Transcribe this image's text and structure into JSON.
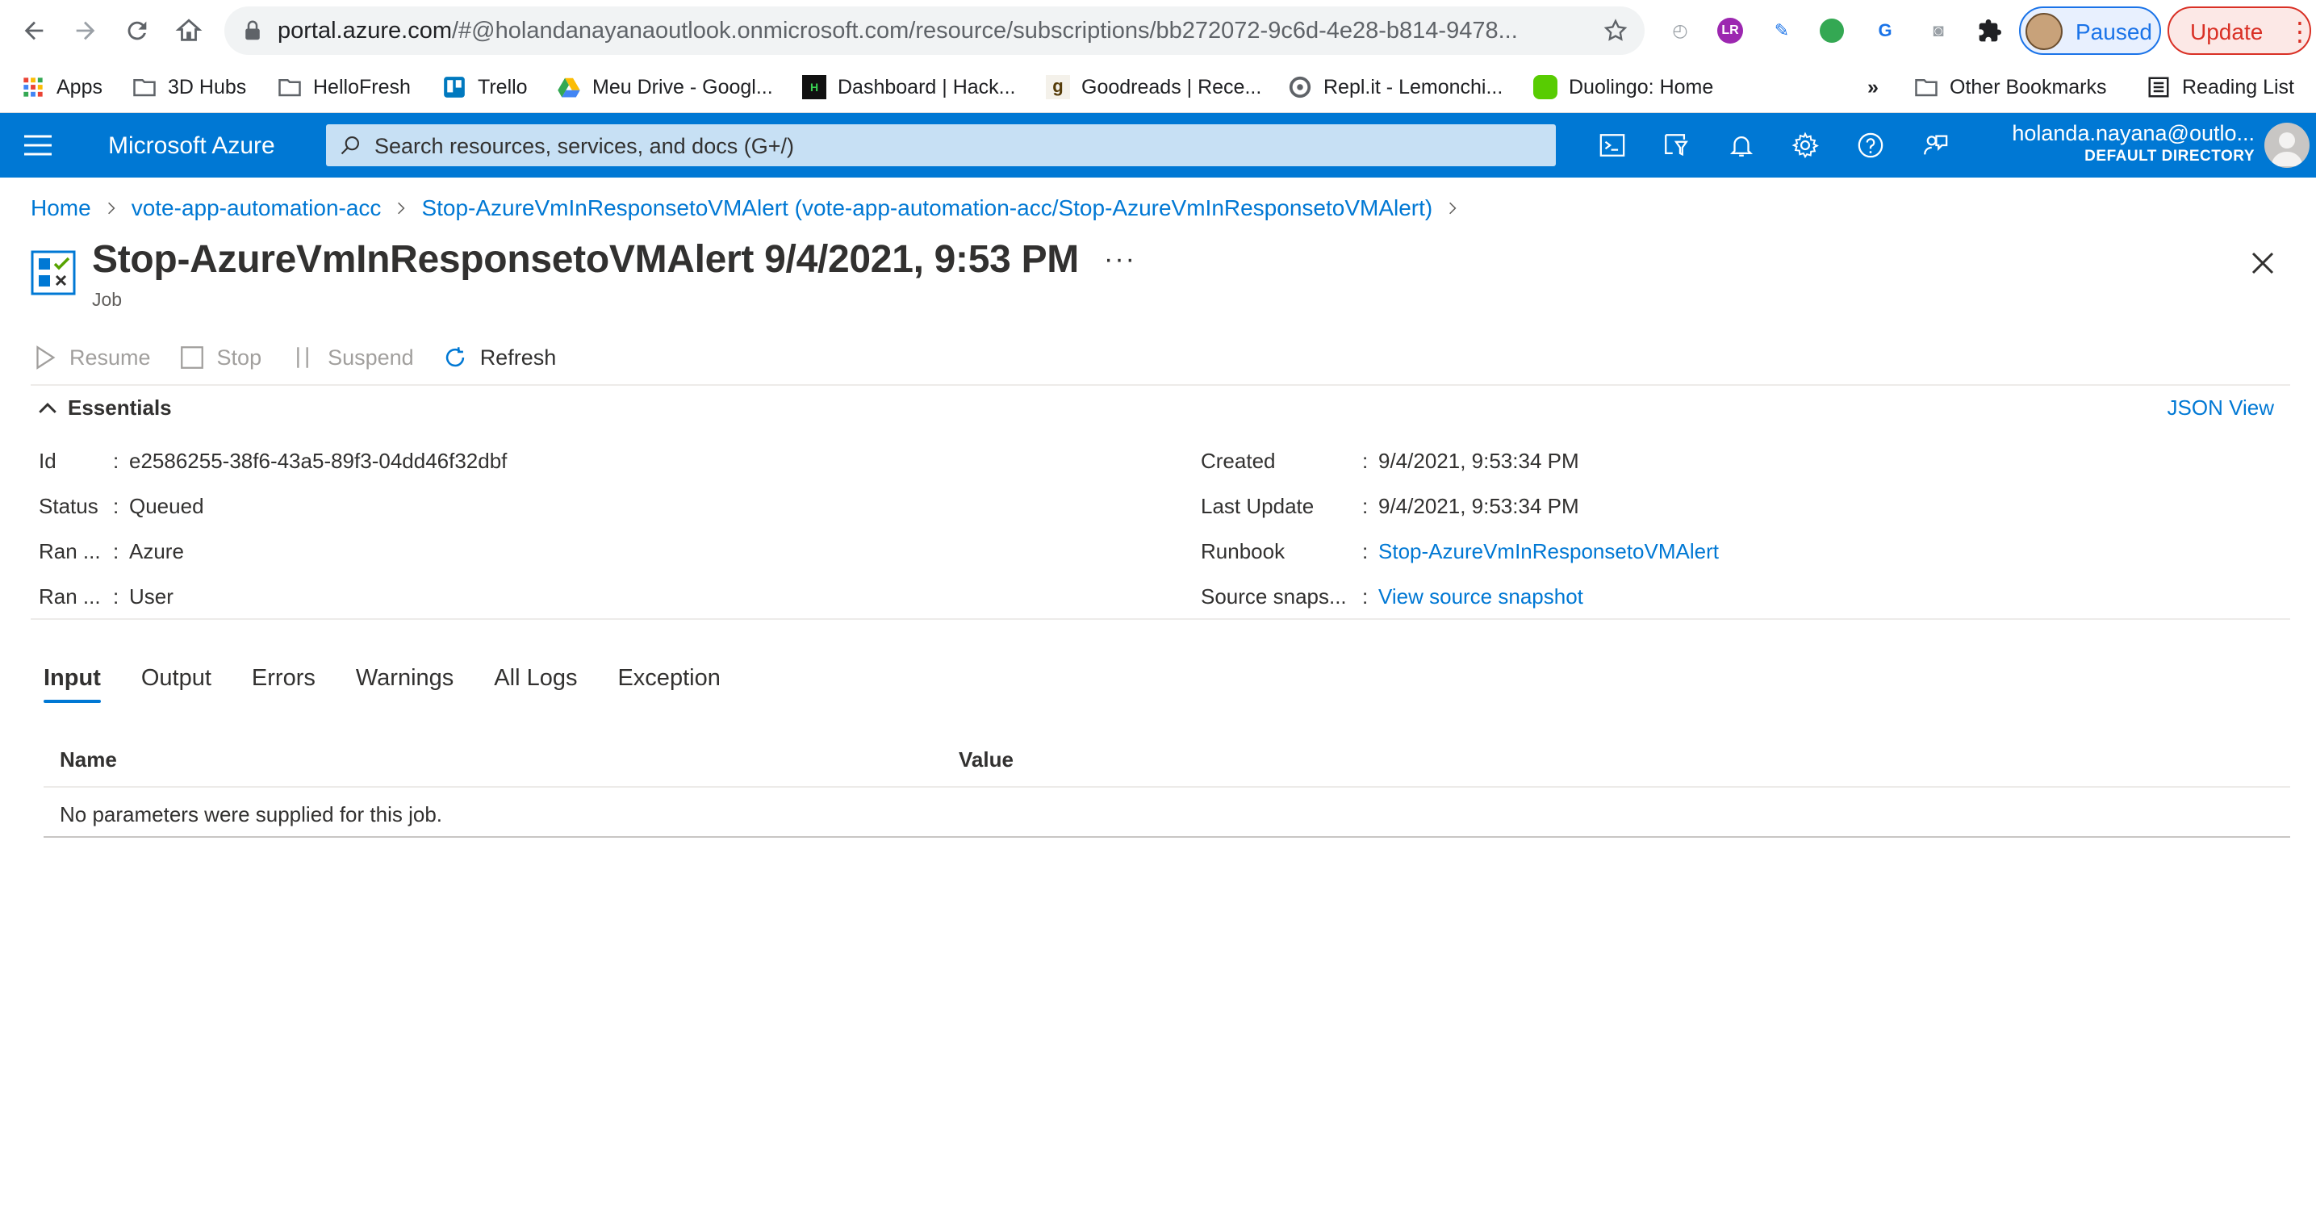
{
  "browser": {
    "url_host": "portal.azure.com",
    "url_path": "/#@holandanayanaoutlook.onmicrosoft.com/resource/subscriptions/bb272072-9c6d-4e28-b814-9478...",
    "profile_label": "Paused",
    "update_label": "Update",
    "bookmarks": [
      {
        "label": "Apps",
        "icon": "apps-grid-icon"
      },
      {
        "label": "3D Hubs",
        "icon": "folder-icon"
      },
      {
        "label": "HelloFresh",
        "icon": "folder-icon"
      },
      {
        "label": "Trello",
        "icon": "trello-icon"
      },
      {
        "label": "Meu Drive - Googl...",
        "icon": "google-drive-icon"
      },
      {
        "label": "Dashboard | Hack...",
        "icon": "hackerrank-icon"
      },
      {
        "label": "Goodreads | Rece...",
        "icon": "goodreads-icon"
      },
      {
        "label": "Repl.it - Lemonchi...",
        "icon": "replit-icon"
      },
      {
        "label": "Duolingo: Home",
        "icon": "duolingo-icon"
      }
    ],
    "bookmarks_overflow": "»",
    "other_bookmarks": "Other Bookmarks",
    "reading_list": "Reading List"
  },
  "azure": {
    "brand": "Microsoft Azure",
    "search_placeholder": "Search resources, services, and docs (G+/)",
    "user_email": "holanda.nayana@outlo...",
    "user_directory": "DEFAULT DIRECTORY"
  },
  "breadcrumb": [
    "Home",
    "vote-app-automation-acc",
    "Stop-AzureVmInResponsetoVMAlert (vote-app-automation-acc/Stop-AzureVmInResponsetoVMAlert)"
  ],
  "page": {
    "title": "Stop-AzureVmInResponsetoVMAlert 9/4/2021, 9:53 PM",
    "subtitle": "Job",
    "more": "···"
  },
  "commands": {
    "resume": "Resume",
    "stop": "Stop",
    "suspend": "Suspend",
    "refresh": "Refresh"
  },
  "essentials": {
    "label": "Essentials",
    "json_view": "JSON View",
    "left": [
      {
        "label": "Id",
        "value": "e2586255-38f6-43a5-89f3-04dd46f32dbf"
      },
      {
        "label": "Status",
        "value": "Queued"
      },
      {
        "label": "Ran ...",
        "value": "Azure"
      },
      {
        "label": "Ran ...",
        "value": "User"
      }
    ],
    "right": [
      {
        "label": "Created",
        "value": "9/4/2021, 9:53:34 PM"
      },
      {
        "label": "Last Update",
        "value": "9/4/2021, 9:53:34 PM"
      },
      {
        "label": "Runbook",
        "value": "Stop-AzureVmInResponsetoVMAlert"
      },
      {
        "label": "Source snaps...",
        "value": "View source snapshot"
      }
    ]
  },
  "tabs": [
    "Input",
    "Output",
    "Errors",
    "Warnings",
    "All Logs",
    "Exception"
  ],
  "grid": {
    "columns": [
      "Name",
      "Value"
    ],
    "empty_message": "No parameters were supplied for this job."
  }
}
